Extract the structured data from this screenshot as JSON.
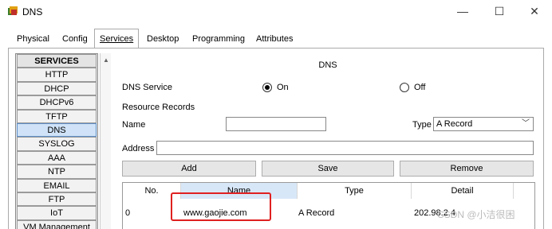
{
  "window": {
    "title": "DNS",
    "minimize_glyph": "—",
    "maximize_glyph": "☐",
    "close_glyph": "✕",
    "icon": "packet-tracer-icon"
  },
  "tabs": [
    {
      "label": "Physical"
    },
    {
      "label": "Config"
    },
    {
      "label": "Services",
      "active": true
    },
    {
      "label": "Desktop"
    },
    {
      "label": "Programming"
    },
    {
      "label": "Attributes"
    }
  ],
  "services": {
    "header": "SERVICES",
    "items": [
      "HTTP",
      "DHCP",
      "DHCPv6",
      "TFTP",
      "DNS",
      "SYSLOG",
      "AAA",
      "NTP",
      "EMAIL",
      "FTP",
      "IoT",
      "VM Management"
    ],
    "selected": "DNS",
    "scroll_up_glyph": "▲"
  },
  "dns": {
    "title": "DNS",
    "service_label": "DNS Service",
    "on_label": "On",
    "off_label": "Off",
    "service_state": "On",
    "resource_records_label": "Resource Records",
    "name_label": "Name",
    "name_value": "",
    "type_label": "Type",
    "type_value": "A Record",
    "type_chevron": "﹀",
    "address_label": "Address",
    "address_value": "",
    "add_button": "Add",
    "save_button": "Save",
    "remove_button": "Remove"
  },
  "table": {
    "headers": [
      "No.",
      "Name",
      "Type",
      "Detail"
    ],
    "rows": [
      {
        "no": "0",
        "name": "www.gaojie.com",
        "type": "A Record",
        "detail": "202.98.2.4"
      }
    ]
  },
  "watermark": "CSDN @小洁很困",
  "colors": {
    "selected_service": "#cfe2f7",
    "header_highlight": "#d8e7f8",
    "annotation_box": "#e02020"
  }
}
